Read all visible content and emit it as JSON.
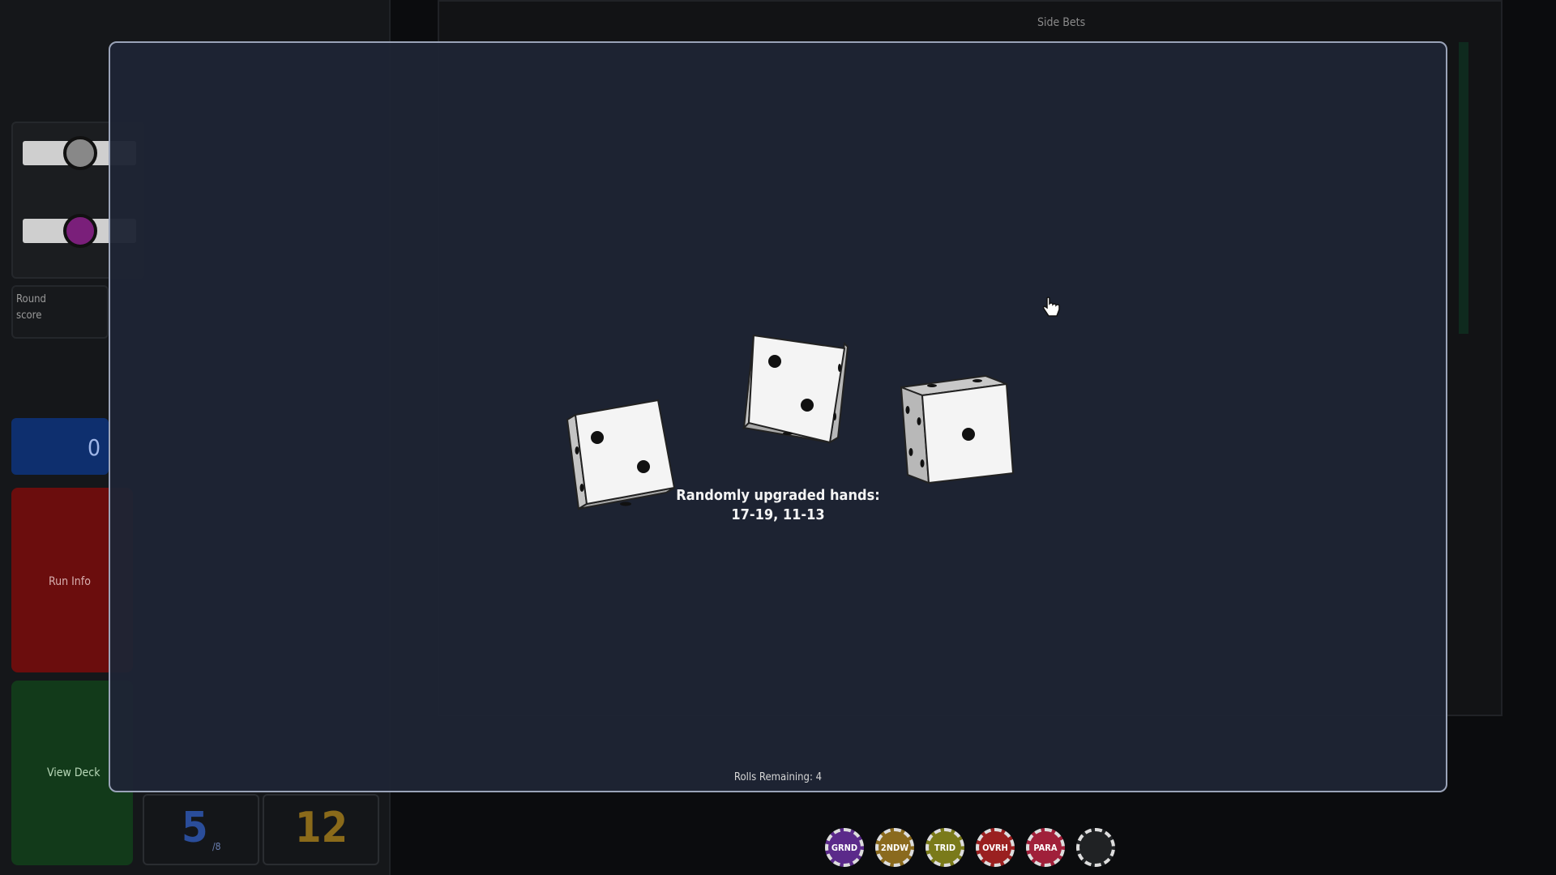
{
  "sidebar": {
    "round_score_label": "Round\nscore",
    "score_value": "0",
    "run_info_label": "Run Info",
    "view_deck_label": "View Deck",
    "hands_value": "5",
    "hands_max": "/8",
    "discards_value": "12"
  },
  "board": {
    "side_bets_label": "Side Bets"
  },
  "chips": [
    {
      "label": "GRND",
      "color": "#5b2a8a"
    },
    {
      "label": "2NDW",
      "color": "#8a6a1e"
    },
    {
      "label": "TRID",
      "color": "#7a7a1a"
    },
    {
      "label": "OVRH",
      "color": "#9a2020"
    },
    {
      "label": "PARA",
      "color": "#a0203a"
    },
    {
      "label": "",
      "color": "#202224"
    }
  ],
  "overlay": {
    "message_line1": "Randomly upgraded hands:",
    "message_line2": "17-19, 11-13",
    "rolls_remaining": "Rolls Remaining: 4"
  },
  "dice": [
    {
      "face": 2
    },
    {
      "face": 2
    },
    {
      "face": 1
    }
  ],
  "colors": {
    "modal_bg": "#1e2434",
    "modal_border": "#9aa3b8",
    "die_face": "#f4f4f4",
    "die_side": "#b8b8b8",
    "pip": "#111111"
  }
}
